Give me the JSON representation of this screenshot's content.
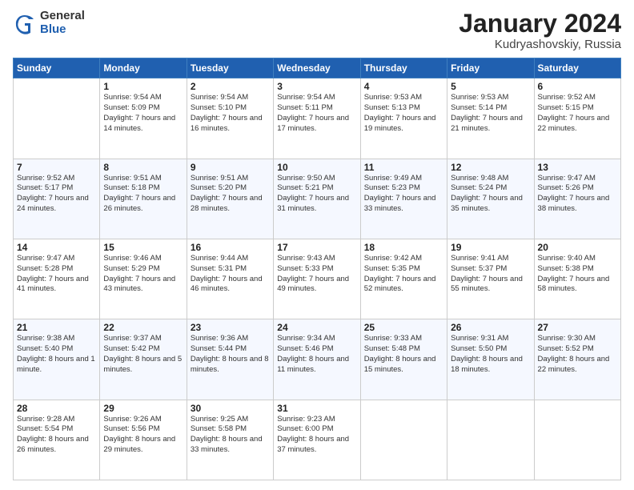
{
  "logo": {
    "general": "General",
    "blue": "Blue"
  },
  "title": {
    "month": "January 2024",
    "location": "Kudryashovskiy, Russia"
  },
  "days_header": [
    "Sunday",
    "Monday",
    "Tuesday",
    "Wednesday",
    "Thursday",
    "Friday",
    "Saturday"
  ],
  "weeks": [
    [
      {
        "day": "",
        "sunrise": "",
        "sunset": "",
        "daylight": ""
      },
      {
        "day": "1",
        "sunrise": "9:54 AM",
        "sunset": "5:09 PM",
        "daylight": "7 hours and 14 minutes."
      },
      {
        "day": "2",
        "sunrise": "9:54 AM",
        "sunset": "5:10 PM",
        "daylight": "7 hours and 16 minutes."
      },
      {
        "day": "3",
        "sunrise": "9:54 AM",
        "sunset": "5:11 PM",
        "daylight": "7 hours and 17 minutes."
      },
      {
        "day": "4",
        "sunrise": "9:53 AM",
        "sunset": "5:13 PM",
        "daylight": "7 hours and 19 minutes."
      },
      {
        "day": "5",
        "sunrise": "9:53 AM",
        "sunset": "5:14 PM",
        "daylight": "7 hours and 21 minutes."
      },
      {
        "day": "6",
        "sunrise": "9:52 AM",
        "sunset": "5:15 PM",
        "daylight": "7 hours and 22 minutes."
      }
    ],
    [
      {
        "day": "7",
        "sunrise": "9:52 AM",
        "sunset": "5:17 PM",
        "daylight": "7 hours and 24 minutes."
      },
      {
        "day": "8",
        "sunrise": "9:51 AM",
        "sunset": "5:18 PM",
        "daylight": "7 hours and 26 minutes."
      },
      {
        "day": "9",
        "sunrise": "9:51 AM",
        "sunset": "5:20 PM",
        "daylight": "7 hours and 28 minutes."
      },
      {
        "day": "10",
        "sunrise": "9:50 AM",
        "sunset": "5:21 PM",
        "daylight": "7 hours and 31 minutes."
      },
      {
        "day": "11",
        "sunrise": "9:49 AM",
        "sunset": "5:23 PM",
        "daylight": "7 hours and 33 minutes."
      },
      {
        "day": "12",
        "sunrise": "9:48 AM",
        "sunset": "5:24 PM",
        "daylight": "7 hours and 35 minutes."
      },
      {
        "day": "13",
        "sunrise": "9:47 AM",
        "sunset": "5:26 PM",
        "daylight": "7 hours and 38 minutes."
      }
    ],
    [
      {
        "day": "14",
        "sunrise": "9:47 AM",
        "sunset": "5:28 PM",
        "daylight": "7 hours and 41 minutes."
      },
      {
        "day": "15",
        "sunrise": "9:46 AM",
        "sunset": "5:29 PM",
        "daylight": "7 hours and 43 minutes."
      },
      {
        "day": "16",
        "sunrise": "9:44 AM",
        "sunset": "5:31 PM",
        "daylight": "7 hours and 46 minutes."
      },
      {
        "day": "17",
        "sunrise": "9:43 AM",
        "sunset": "5:33 PM",
        "daylight": "7 hours and 49 minutes."
      },
      {
        "day": "18",
        "sunrise": "9:42 AM",
        "sunset": "5:35 PM",
        "daylight": "7 hours and 52 minutes."
      },
      {
        "day": "19",
        "sunrise": "9:41 AM",
        "sunset": "5:37 PM",
        "daylight": "7 hours and 55 minutes."
      },
      {
        "day": "20",
        "sunrise": "9:40 AM",
        "sunset": "5:38 PM",
        "daylight": "7 hours and 58 minutes."
      }
    ],
    [
      {
        "day": "21",
        "sunrise": "9:38 AM",
        "sunset": "5:40 PM",
        "daylight": "8 hours and 1 minute."
      },
      {
        "day": "22",
        "sunrise": "9:37 AM",
        "sunset": "5:42 PM",
        "daylight": "8 hours and 5 minutes."
      },
      {
        "day": "23",
        "sunrise": "9:36 AM",
        "sunset": "5:44 PM",
        "daylight": "8 hours and 8 minutes."
      },
      {
        "day": "24",
        "sunrise": "9:34 AM",
        "sunset": "5:46 PM",
        "daylight": "8 hours and 11 minutes."
      },
      {
        "day": "25",
        "sunrise": "9:33 AM",
        "sunset": "5:48 PM",
        "daylight": "8 hours and 15 minutes."
      },
      {
        "day": "26",
        "sunrise": "9:31 AM",
        "sunset": "5:50 PM",
        "daylight": "8 hours and 18 minutes."
      },
      {
        "day": "27",
        "sunrise": "9:30 AM",
        "sunset": "5:52 PM",
        "daylight": "8 hours and 22 minutes."
      }
    ],
    [
      {
        "day": "28",
        "sunrise": "9:28 AM",
        "sunset": "5:54 PM",
        "daylight": "8 hours and 26 minutes."
      },
      {
        "day": "29",
        "sunrise": "9:26 AM",
        "sunset": "5:56 PM",
        "daylight": "8 hours and 29 minutes."
      },
      {
        "day": "30",
        "sunrise": "9:25 AM",
        "sunset": "5:58 PM",
        "daylight": "8 hours and 33 minutes."
      },
      {
        "day": "31",
        "sunrise": "9:23 AM",
        "sunset": "6:00 PM",
        "daylight": "8 hours and 37 minutes."
      },
      {
        "day": "",
        "sunrise": "",
        "sunset": "",
        "daylight": ""
      },
      {
        "day": "",
        "sunrise": "",
        "sunset": "",
        "daylight": ""
      },
      {
        "day": "",
        "sunrise": "",
        "sunset": "",
        "daylight": ""
      }
    ]
  ]
}
